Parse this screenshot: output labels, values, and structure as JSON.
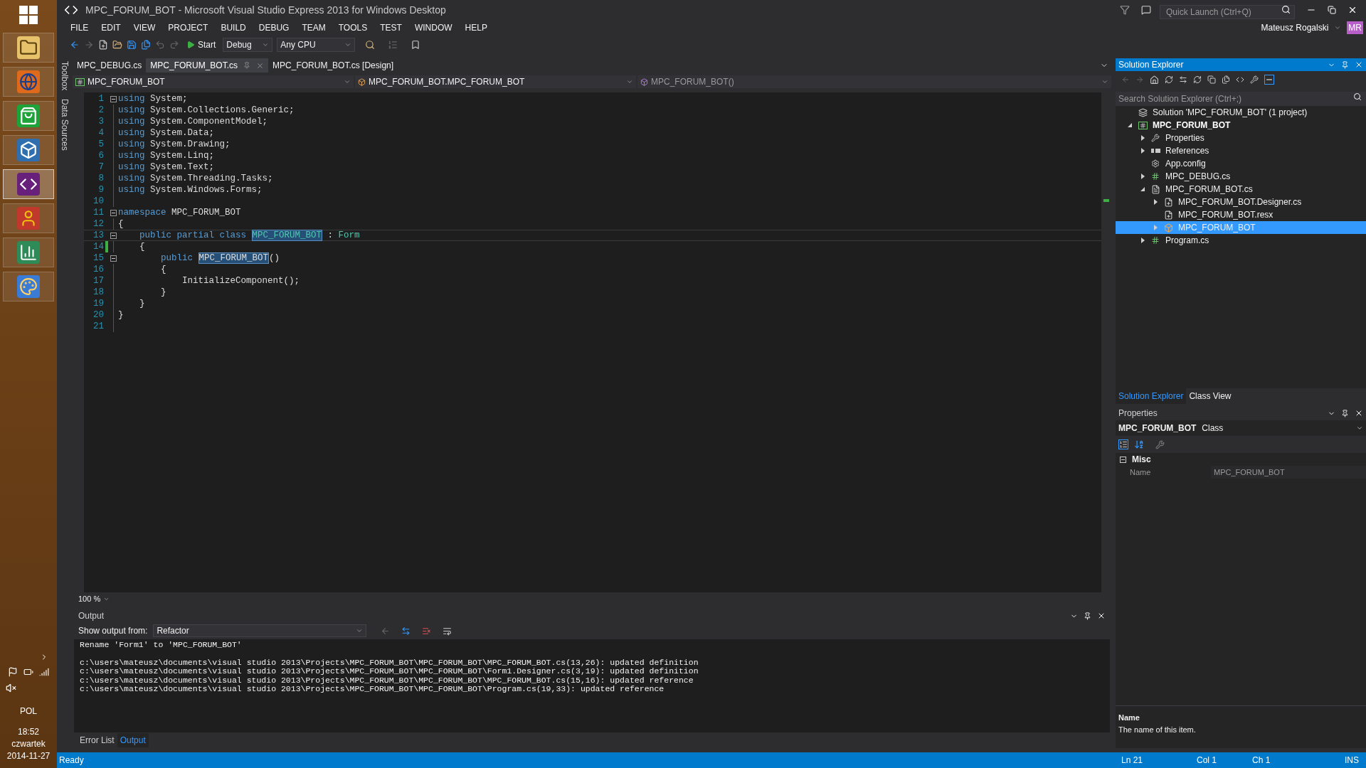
{
  "taskbar": {
    "apps": [
      {
        "kind": "explorer",
        "selected": false
      },
      {
        "kind": "firefox",
        "selected": false
      },
      {
        "kind": "store",
        "selected": false
      },
      {
        "kind": "cube",
        "selected": false
      },
      {
        "kind": "visualstudio",
        "selected": true
      },
      {
        "kind": "game",
        "selected": false
      },
      {
        "kind": "chart",
        "selected": false
      },
      {
        "kind": "paint",
        "selected": false
      }
    ],
    "language": "POL",
    "time": "18:52",
    "day": "czwartek",
    "date": "2014-11-27"
  },
  "window": {
    "title": "MPC_FORUM_BOT - Microsoft Visual Studio Express 2013 for Windows Desktop",
    "quick_launch": {
      "placeholder": "Quick Launch (Ctrl+Q)"
    },
    "user": "Mateusz Rogalski",
    "user_initials": "MR"
  },
  "menu": [
    "FILE",
    "EDIT",
    "VIEW",
    "PROJECT",
    "BUILD",
    "DEBUG",
    "TEAM",
    "TOOLS",
    "TEST",
    "WINDOW",
    "HELP"
  ],
  "toolbar": {
    "start": "Start",
    "configuration": "Debug",
    "platform": "Any CPU"
  },
  "side_tabs": [
    "Toolbox",
    "Data Sources"
  ],
  "doc_tabs": [
    {
      "label": "MPC_DEBUG.cs",
      "selected": false
    },
    {
      "label": "MPC_FORUM_BOT.cs",
      "selected": true
    },
    {
      "label": "MPC_FORUM_BOT.cs [Design]",
      "selected": false
    }
  ],
  "nav_bar": {
    "project": "MPC_FORUM_BOT",
    "type": "MPC_FORUM_BOT.MPC_FORUM_BOT",
    "member": "MPC_FORUM_BOT()"
  },
  "code": [
    {
      "number": "1",
      "fold": true,
      "changed": false,
      "tokens": [
        {
          "kind": "kw",
          "text": "using"
        },
        {
          "kind": "plain",
          "text": " System;"
        }
      ]
    },
    {
      "number": "2",
      "fold": false,
      "changed": false,
      "tokens": [
        {
          "kind": "kw",
          "text": "using"
        },
        {
          "kind": "plain",
          "text": " System.Collections.Generic;"
        }
      ]
    },
    {
      "number": "3",
      "fold": false,
      "changed": false,
      "tokens": [
        {
          "kind": "kw",
          "text": "using"
        },
        {
          "kind": "plain",
          "text": " System.ComponentModel;"
        }
      ]
    },
    {
      "number": "4",
      "fold": false,
      "changed": false,
      "tokens": [
        {
          "kind": "kw",
          "text": "using"
        },
        {
          "kind": "plain",
          "text": " System.Data;"
        }
      ]
    },
    {
      "number": "5",
      "fold": false,
      "changed": false,
      "tokens": [
        {
          "kind": "kw",
          "text": "using"
        },
        {
          "kind": "plain",
          "text": " System.Drawing;"
        }
      ]
    },
    {
      "number": "6",
      "fold": false,
      "changed": false,
      "tokens": [
        {
          "kind": "kw",
          "text": "using"
        },
        {
          "kind": "plain",
          "text": " System.Linq;"
        }
      ]
    },
    {
      "number": "7",
      "fold": false,
      "changed": false,
      "tokens": [
        {
          "kind": "kw",
          "text": "using"
        },
        {
          "kind": "plain",
          "text": " System.Text;"
        }
      ]
    },
    {
      "number": "8",
      "fold": false,
      "changed": false,
      "tokens": [
        {
          "kind": "kw",
          "text": "using"
        },
        {
          "kind": "plain",
          "text": " System.Threading.Tasks;"
        }
      ]
    },
    {
      "number": "9",
      "fold": false,
      "changed": false,
      "tokens": [
        {
          "kind": "kw",
          "text": "using"
        },
        {
          "kind": "plain",
          "text": " System.Windows.Forms;"
        }
      ]
    },
    {
      "number": "10",
      "fold": false,
      "changed": false
    },
    {
      "number": "11",
      "fold": true,
      "changed": false,
      "tokens": [
        {
          "kind": "kw",
          "text": "namespace"
        },
        {
          "kind": "plain",
          "text": " MPC_FORUM_BOT"
        }
      ]
    },
    {
      "number": "12",
      "fold": false,
      "changed": false,
      "tokens": [
        {
          "kind": "plain",
          "text": "{"
        }
      ]
    },
    {
      "number": "13",
      "fold": true,
      "changed": false,
      "tokens": [
        {
          "kind": "kw",
          "text": "    public partial class "
        },
        {
          "kind": "type_ref",
          "text": "MPC_FORUM_BOT"
        },
        {
          "kind": "plain",
          "text": " : "
        },
        {
          "kind": "type",
          "text": "Form"
        }
      ]
    },
    {
      "number": "14",
      "fold": false,
      "changed": true,
      "tokens": [
        {
          "kind": "plain",
          "text": "    {"
        }
      ]
    },
    {
      "number": "15",
      "fold": true,
      "changed": false,
      "tokens": [
        {
          "kind": "kw",
          "text": "        public "
        },
        {
          "kind": "ref",
          "text": "MPC_FORUM_BOT"
        },
        {
          "kind": "plain",
          "text": "()"
        }
      ]
    },
    {
      "number": "16",
      "fold": false,
      "changed": false,
      "tokens": [
        {
          "kind": "plain",
          "text": "        {"
        }
      ]
    },
    {
      "number": "17",
      "fold": false,
      "changed": false,
      "tokens": [
        {
          "kind": "plain",
          "text": "            InitializeComponent();"
        }
      ]
    },
    {
      "number": "18",
      "fold": false,
      "changed": false,
      "tokens": [
        {
          "kind": "plain",
          "text": "        }"
        }
      ]
    },
    {
      "number": "19",
      "fold": false,
      "changed": false,
      "tokens": [
        {
          "kind": "plain",
          "text": "    }"
        }
      ]
    },
    {
      "number": "20",
      "fold": false,
      "changed": false,
      "tokens": [
        {
          "kind": "plain",
          "text": "}"
        }
      ]
    },
    {
      "number": "21",
      "fold": false,
      "changed": false
    }
  ],
  "zoom": "100 %",
  "output": {
    "title": "Output",
    "source_label": "Show output from:",
    "source": "Refactor",
    "groups": [
      [
        "Rename 'Form1' to 'MPC_FORUM_BOT'"
      ],
      [
        "c:\\users\\mateusz\\documents\\visual studio 2013\\Projects\\MPC_FORUM_BOT\\MPC_FORUM_BOT\\MPC_FORUM_BOT.cs(13,26): updated definition",
        "c:\\users\\mateusz\\documents\\visual studio 2013\\Projects\\MPC_FORUM_BOT\\MPC_FORUM_BOT\\Form1.Designer.cs(3,19): updated definition",
        "c:\\users\\mateusz\\documents\\visual studio 2013\\Projects\\MPC_FORUM_BOT\\MPC_FORUM_BOT\\MPC_FORUM_BOT.cs(15,16): updated reference",
        "c:\\users\\mateusz\\documents\\visual studio 2013\\Projects\\MPC_FORUM_BOT\\MPC_FORUM_BOT\\Program.cs(19,33): updated reference"
      ]
    ]
  },
  "bottom_tabs": [
    {
      "label": "Error List",
      "selected": false
    },
    {
      "label": "Output",
      "selected": true
    }
  ],
  "solution_explorer": {
    "title": "Solution Explorer",
    "search": {
      "placeholder": "Search Solution Explorer (Ctrl+;)"
    },
    "tree": [
      {
        "label": "Solution 'MPC_FORUM_BOT' (1 project)",
        "kind": "solution",
        "selected": false,
        "children": [
          {
            "label": "MPC_FORUM_BOT",
            "kind": "project",
            "expandable": true,
            "expanded": true,
            "selected": false,
            "children": [
              {
                "label": "Properties",
                "kind": "properties",
                "expandable": true,
                "expanded": false,
                "selected": false
              },
              {
                "label": "References",
                "kind": "references",
                "expandable": true,
                "expanded": false,
                "selected": false
              },
              {
                "label": "App.config",
                "kind": "config",
                "expandable": false,
                "expanded": false,
                "selected": false
              },
              {
                "label": "MPC_DEBUG.cs",
                "kind": "csharp",
                "expandable": true,
                "expanded": false,
                "selected": false
              },
              {
                "label": "MPC_FORUM_BOT.cs",
                "kind": "form",
                "expandable": true,
                "expanded": true,
                "selected": false,
                "children": [
                  {
                    "label": "MPC_FORUM_BOT.Designer.cs",
                    "kind": "file",
                    "expandable": true,
                    "expanded": false,
                    "selected": false
                  },
                  {
                    "label": "MPC_FORUM_BOT.resx",
                    "kind": "file",
                    "expandable": false,
                    "expanded": false,
                    "selected": false
                  },
                  {
                    "label": "MPC_FORUM_BOT",
                    "kind": "class",
                    "expandable": true,
                    "expanded": false,
                    "selected": true
                  }
                ]
              },
              {
                "label": "Program.cs",
                "kind": "csharp",
                "expandable": true,
                "expanded": false,
                "selected": false
              }
            ]
          }
        ]
      }
    ]
  },
  "panel_tabs": [
    {
      "label": "Solution Explorer",
      "selected": true
    },
    {
      "label": "Class View",
      "selected": false
    }
  ],
  "properties": {
    "title": "Properties",
    "object": "MPC_FORUM_BOT",
    "object_type": "Class",
    "category": "Misc",
    "expanded": true,
    "rows": [
      {
        "name": "Name",
        "value": "MPC_FORUM_BOT"
      }
    ],
    "description_title": "Name",
    "description": "The name of this item."
  },
  "status_bar": {
    "text": "Ready",
    "line": "Ln 21",
    "col": "Col 1",
    "ch": "Ch 1",
    "mode": "INS"
  }
}
